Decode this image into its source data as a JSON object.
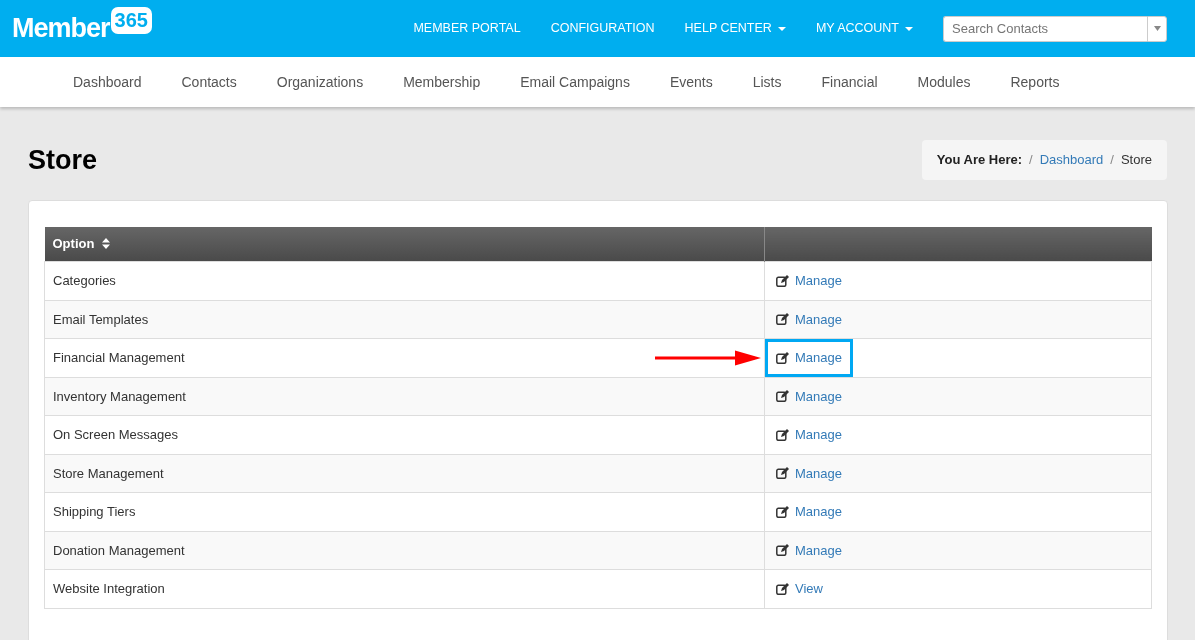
{
  "logo": {
    "word": "Member",
    "badge": "365"
  },
  "top_menu": [
    {
      "label": "MEMBER PORTAL",
      "dropdown": false
    },
    {
      "label": "CONFIGURATION",
      "dropdown": false
    },
    {
      "label": "HELP CENTER",
      "dropdown": true
    },
    {
      "label": "MY ACCOUNT",
      "dropdown": true
    }
  ],
  "search": {
    "placeholder": "Search Contacts"
  },
  "main_nav": [
    "Dashboard",
    "Contacts",
    "Organizations",
    "Membership",
    "Email Campaigns",
    "Events",
    "Lists",
    "Financial",
    "Modules",
    "Reports"
  ],
  "page_title": "Store",
  "breadcrumb": {
    "label": "You Are Here:",
    "separator": "/",
    "items": [
      {
        "text": "Dashboard",
        "link": true
      },
      {
        "text": "Store",
        "link": false
      }
    ]
  },
  "table": {
    "columns": [
      "Option"
    ],
    "rows": [
      {
        "option": "Categories",
        "action": "Manage",
        "highlighted": false
      },
      {
        "option": "Email Templates",
        "action": "Manage",
        "highlighted": false
      },
      {
        "option": "Financial Management",
        "action": "Manage",
        "highlighted": true
      },
      {
        "option": "Inventory Management",
        "action": "Manage",
        "highlighted": false
      },
      {
        "option": "On Screen Messages",
        "action": "Manage",
        "highlighted": false
      },
      {
        "option": "Store Management",
        "action": "Manage",
        "highlighted": false
      },
      {
        "option": "Shipping Tiers",
        "action": "Manage",
        "highlighted": false
      },
      {
        "option": "Donation Management",
        "action": "Manage",
        "highlighted": false
      },
      {
        "option": "Website Integration",
        "action": "View",
        "highlighted": false
      }
    ]
  }
}
